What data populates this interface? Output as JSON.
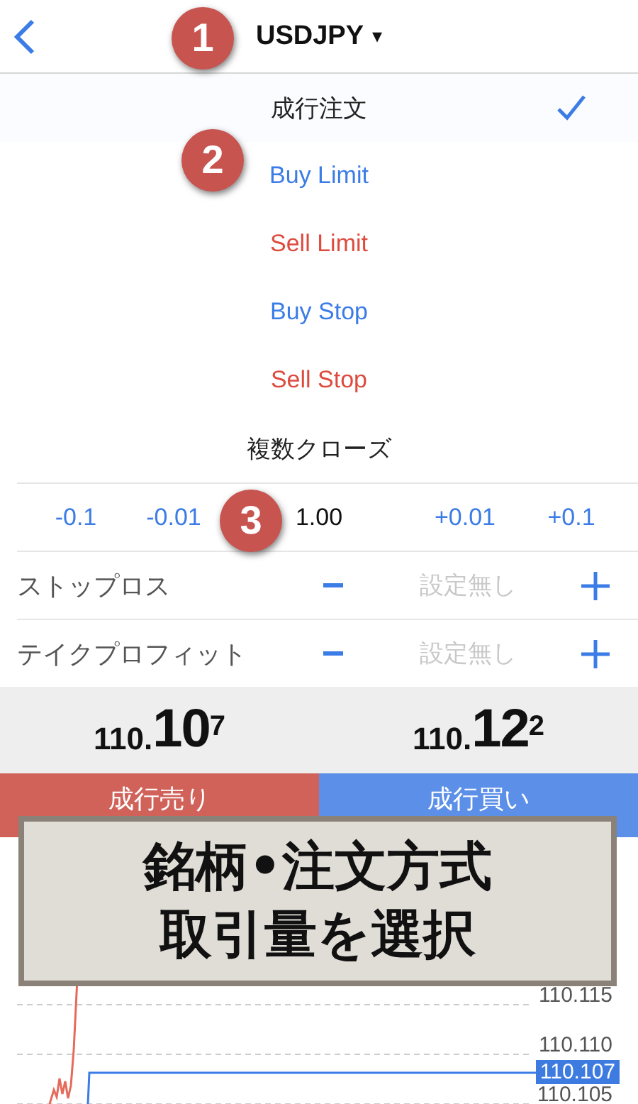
{
  "header": {
    "symbol": "USDJPY",
    "dropdown_glyph": "▾"
  },
  "order_types": [
    {
      "label": "成行注文",
      "kind": "market",
      "selected": true
    },
    {
      "label": "Buy Limit",
      "kind": "buy",
      "selected": false
    },
    {
      "label": "Sell Limit",
      "kind": "sell",
      "selected": false
    },
    {
      "label": "Buy Stop",
      "kind": "buy",
      "selected": false
    },
    {
      "label": "Sell Stop",
      "kind": "sell",
      "selected": false
    },
    {
      "label": "複数クローズ",
      "kind": "market",
      "selected": false
    }
  ],
  "volume": {
    "steps_down": [
      "-0.1",
      "-0.01"
    ],
    "value": "1.00",
    "steps_up": [
      "+0.01",
      "+0.1"
    ]
  },
  "levels": [
    {
      "label": "ストップロス",
      "placeholder": "設定無し"
    },
    {
      "label": "テイクプロフィット",
      "placeholder": "設定無し"
    }
  ],
  "prices": [
    {
      "prefix": "110.",
      "main": "10",
      "last": "7"
    },
    {
      "prefix": "110.",
      "main": "12",
      "last": "2"
    }
  ],
  "actions": [
    {
      "label": "成行売り",
      "kind": "sell"
    },
    {
      "label": "成行買い",
      "kind": "buy"
    }
  ],
  "chart": {
    "grid_labels": [
      "110.115",
      "110.110",
      "110.105"
    ],
    "current_price": "110.107"
  },
  "badges": [
    "1",
    "2",
    "3"
  ],
  "caption": [
    "銘柄•注文方式",
    "取引量を選択"
  ]
}
